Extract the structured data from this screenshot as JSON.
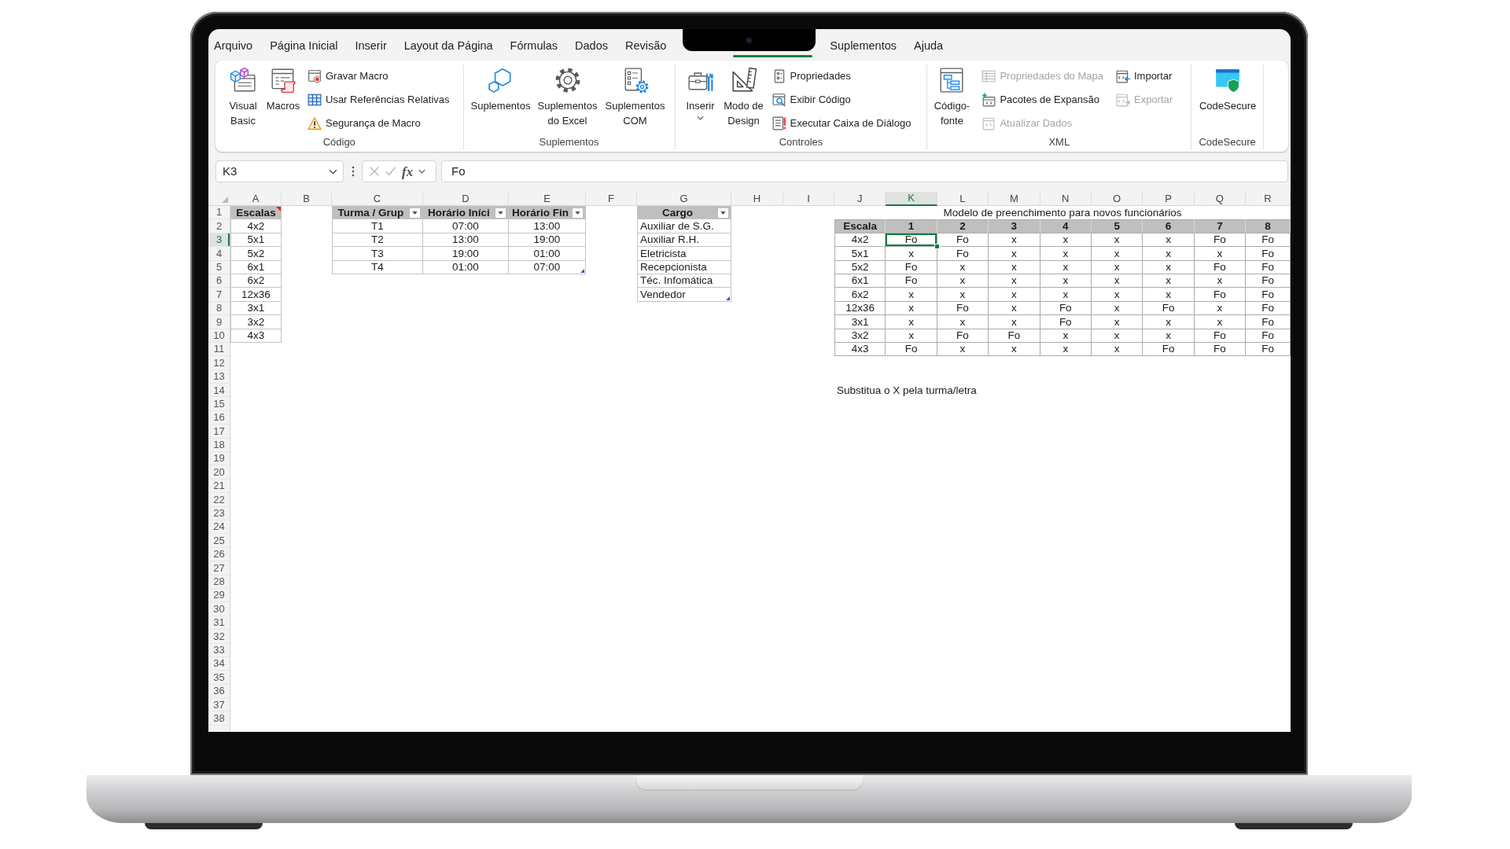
{
  "tabs": [
    {
      "label": "Arquivo",
      "selected": false
    },
    {
      "label": "Página Inicial",
      "selected": false
    },
    {
      "label": "Inserir",
      "selected": false
    },
    {
      "label": "Layout da Página",
      "selected": false
    },
    {
      "label": "Fórmulas",
      "selected": false
    },
    {
      "label": "Dados",
      "selected": false
    },
    {
      "label": "Revisão",
      "selected": false
    },
    {
      "selected": true
    },
    {
      "label": "Suplementos",
      "selected": false
    },
    {
      "label": "Ajuda",
      "selected": false
    }
  ],
  "ribbon_groups": [
    {
      "label": "Código",
      "items": [
        {
          "kind": "large",
          "label": "Visual Basic"
        },
        {
          "kind": "large",
          "label": "Macros"
        },
        {
          "kind": "small",
          "label": "Gravar Macro"
        },
        {
          "kind": "small",
          "label": "Usar Referências Relativas"
        },
        {
          "kind": "small",
          "label": "Segurança de Macro"
        }
      ]
    },
    {
      "label": "Suplementos",
      "items": [
        {
          "kind": "large",
          "label": "Suplementos"
        },
        {
          "kind": "large",
          "label": "Suplementos do Excel"
        },
        {
          "kind": "large",
          "label": "Suplementos COM"
        }
      ]
    },
    {
      "label": "Controles",
      "items": [
        {
          "kind": "large",
          "label": "Inserir",
          "dropdown": true
        },
        {
          "kind": "large",
          "label": "Modo de Design"
        },
        {
          "kind": "small",
          "label": "Propriedades"
        },
        {
          "kind": "small",
          "label": "Exibir Código"
        },
        {
          "kind": "small",
          "label": "Executar Caixa de Diálogo"
        }
      ]
    },
    {
      "label": "XML",
      "items": [
        {
          "kind": "large",
          "label": "Código-fonte",
          "disabled": false
        },
        {
          "kind": "small",
          "label": "Propriedades do Mapa",
          "disabled": true
        },
        {
          "kind": "small",
          "label": "Pacotes de Expansão",
          "disabled": false
        },
        {
          "kind": "small",
          "label": "Atualizar Dados",
          "disabled": true
        },
        {
          "kind": "small",
          "label": "Importar",
          "disabled": false
        },
        {
          "kind": "small",
          "label": "Exportar",
          "disabled": true
        }
      ]
    },
    {
      "label": "CodeSecure",
      "items": [
        {
          "kind": "large",
          "label": "CodeSecure"
        }
      ]
    }
  ],
  "formula_bar": {
    "name_box": "K3",
    "function_button": "fx",
    "formula": "Fo"
  },
  "sheet": {
    "columns": [
      {
        "label": "A",
        "selected": false
      },
      {
        "label": "B",
        "selected": false
      },
      {
        "label": "C",
        "selected": false
      },
      {
        "label": "D",
        "selected": false
      },
      {
        "label": "E",
        "selected": false
      },
      {
        "label": "F",
        "selected": false
      },
      {
        "label": "G",
        "selected": false
      },
      {
        "label": "H",
        "selected": false
      },
      {
        "label": "I",
        "selected": false
      },
      {
        "label": "J",
        "selected": false
      },
      {
        "label": "K",
        "selected": true
      },
      {
        "label": "L",
        "selected": false
      },
      {
        "label": "M",
        "selected": false
      },
      {
        "label": "N",
        "selected": false
      },
      {
        "label": "O",
        "selected": false
      },
      {
        "label": "P",
        "selected": false
      },
      {
        "label": "Q",
        "selected": false
      },
      {
        "label": "R",
        "selected": false
      }
    ],
    "rows": [
      {
        "label": "1",
        "selected": false
      },
      {
        "label": "2",
        "selected": false
      },
      {
        "label": "3",
        "selected": true
      },
      {
        "label": "4",
        "selected": false
      },
      {
        "label": "5",
        "selected": false
      },
      {
        "label": "6",
        "selected": false
      },
      {
        "label": "7",
        "selected": false
      },
      {
        "label": "8",
        "selected": false
      },
      {
        "label": "9",
        "selected": false
      },
      {
        "label": "10",
        "selected": false
      },
      {
        "label": "11",
        "selected": false
      },
      {
        "label": "12",
        "selected": false
      },
      {
        "label": "13",
        "selected": false
      },
      {
        "label": "14",
        "selected": false
      },
      {
        "label": "15",
        "selected": false
      },
      {
        "label": "16",
        "selected": false
      },
      {
        "label": "17",
        "selected": false
      },
      {
        "label": "18",
        "selected": false
      },
      {
        "label": "19",
        "selected": false
      },
      {
        "label": "20",
        "selected": false
      },
      {
        "label": "21",
        "selected": false
      },
      {
        "label": "22",
        "selected": false
      },
      {
        "label": "23",
        "selected": false
      },
      {
        "label": "24",
        "selected": false
      },
      {
        "label": "25",
        "selected": false
      },
      {
        "label": "26",
        "selected": false
      },
      {
        "label": "27",
        "selected": false
      },
      {
        "label": "28",
        "selected": false
      },
      {
        "label": "29",
        "selected": false
      },
      {
        "label": "30",
        "selected": false
      },
      {
        "label": "31",
        "selected": false
      },
      {
        "label": "32",
        "selected": false
      },
      {
        "label": "33",
        "selected": false
      },
      {
        "label": "34",
        "selected": false
      },
      {
        "label": "35",
        "selected": false
      },
      {
        "label": "36",
        "selected": false
      },
      {
        "label": "37",
        "selected": false
      },
      {
        "label": "38",
        "selected": false
      }
    ]
  },
  "escalas_table": {
    "header": "Escalas",
    "has_comment": true,
    "rows": [
      "4x2",
      "5x1",
      "5x2",
      "6x1",
      "6x2",
      "12x36",
      "3x1",
      "3x2",
      "4x3"
    ]
  },
  "turma_table": {
    "columns": [
      "Turma / Grup",
      "Horário Iníci",
      "Horário Fin"
    ],
    "rows": [
      [
        "T1",
        "07:00",
        "13:00"
      ],
      [
        "T2",
        "13:00",
        "19:00"
      ],
      [
        "T3",
        "19:00",
        "01:00"
      ],
      [
        "T4",
        "01:00",
        "07:00"
      ]
    ]
  },
  "cargo_table": {
    "header": "Cargo",
    "rows": [
      "Auxiliar de S.G.",
      "Auxiliar R.H.",
      "Eletricista",
      "Recepcionista",
      "Téc. Infomática",
      "Vendedor"
    ]
  },
  "schedule_table": {
    "title": "Modelo de preenchimento para novos funcionários",
    "columns": [
      "Escala",
      "1",
      "2",
      "3",
      "4",
      "5",
      "6",
      "7",
      "8"
    ],
    "rows": [
      {
        "escala": "4x2",
        "days": [
          "Fo",
          "Fo",
          "x",
          "x",
          "x",
          "x",
          "Fo",
          "Fo"
        ]
      },
      {
        "escala": "5x1",
        "days": [
          "x",
          "Fo",
          "x",
          "x",
          "x",
          "x",
          "x",
          "Fo"
        ]
      },
      {
        "escala": "5x2",
        "days": [
          "Fo",
          "x",
          "x",
          "x",
          "x",
          "x",
          "Fo",
          "Fo"
        ]
      },
      {
        "escala": "6x1",
        "days": [
          "Fo",
          "x",
          "x",
          "x",
          "x",
          "x",
          "x",
          "Fo"
        ]
      },
      {
        "escala": "6x2",
        "days": [
          "x",
          "x",
          "x",
          "x",
          "x",
          "x",
          "Fo",
          "Fo"
        ]
      },
      {
        "escala": "12x36",
        "days": [
          "x",
          "Fo",
          "x",
          "Fo",
          "x",
          "Fo",
          "x",
          "Fo"
        ]
      },
      {
        "escala": "3x1",
        "days": [
          "x",
          "x",
          "x",
          "Fo",
          "x",
          "x",
          "x",
          "Fo"
        ]
      },
      {
        "escala": "3x2",
        "days": [
          "x",
          "Fo",
          "Fo",
          "x",
          "x",
          "x",
          "Fo",
          "Fo"
        ]
      },
      {
        "escala": "4x3",
        "days": [
          "Fo",
          "x",
          "x",
          "x",
          "x",
          "Fo",
          "Fo",
          "Fo"
        ]
      }
    ]
  },
  "note": "Substitua o X pela turma/letra"
}
